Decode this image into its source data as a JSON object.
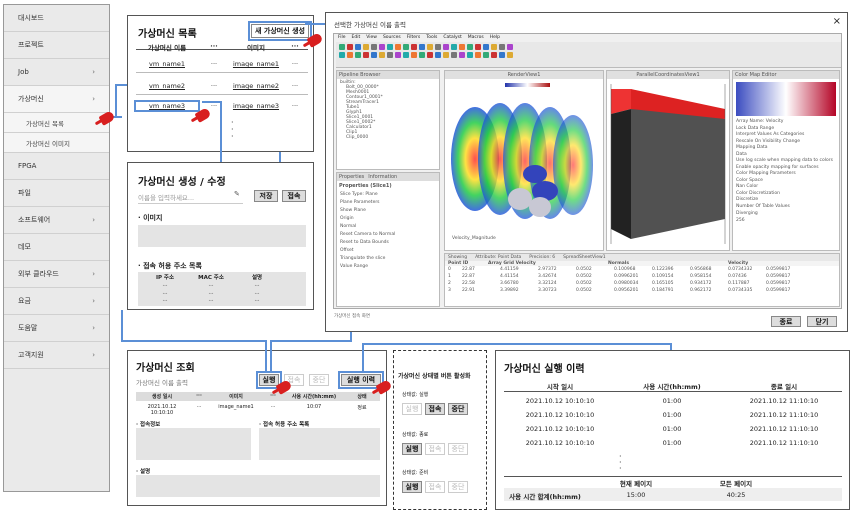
{
  "sidebar": {
    "items": [
      {
        "label": "대시보드",
        "chev": ""
      },
      {
        "label": "프로젝트",
        "chev": ""
      },
      {
        "label": "Job",
        "chev": "›"
      },
      {
        "label": "가상머신",
        "chev": "›"
      }
    ],
    "subitems": [
      "가상머신 목록",
      "가상머신 이미지"
    ],
    "items2": [
      {
        "label": "FPGA",
        "chev": ""
      },
      {
        "label": "파일",
        "chev": ""
      },
      {
        "label": "소프트웨어",
        "chev": "›"
      },
      {
        "label": "데모",
        "chev": ""
      },
      {
        "label": "외부 클라우드",
        "chev": "›"
      },
      {
        "label": "요금",
        "chev": "›"
      },
      {
        "label": "도움말",
        "chev": "›"
      },
      {
        "label": "고객지원",
        "chev": "›"
      }
    ]
  },
  "vm_list": {
    "title": "가상머신 목록",
    "new_button": "새 가상머신 생성",
    "headers": [
      "가상머신 이름",
      "···",
      "이미지",
      "···"
    ],
    "rows": [
      [
        "vm_name1",
        "···",
        "image_name1",
        "···"
      ],
      [
        "vm_name2",
        "···",
        "image_name2",
        "···"
      ],
      [
        "vm_name3",
        "···",
        "image_name3",
        "···"
      ]
    ],
    "more": "·"
  },
  "vm_edit": {
    "title": "가상머신 생성 / 수정",
    "name_placeholder": "이름을 입력하세요...",
    "save": "저장",
    "connect": "접속",
    "image_label": "· 이미지",
    "access_label": "· 접속 허용 주소 목록",
    "access_headers": [
      "IP 주소",
      "MAC 주소",
      "설명"
    ],
    "access_rows": [
      [
        "···",
        "···",
        "···"
      ],
      [
        "···",
        "···",
        "···"
      ],
      [
        "···",
        "···",
        "···"
      ]
    ]
  },
  "vm_view": {
    "title": "가상머신 조회",
    "subtitle": "가상머신 이름 출력",
    "buttons": {
      "run": "실행",
      "connect": "접속",
      "stop": "중단",
      "history": "실행 이력"
    },
    "headers": [
      "생성 일시",
      "···",
      "이미지",
      "···",
      "사용 시간(hh:mm)",
      "상태"
    ],
    "row": [
      "2021.10.12 10:10:10",
      "···",
      "image_name1",
      "···",
      "10:07",
      "정료"
    ],
    "sec_connect": "· 접속정보",
    "sec_access": "· 접속 허용 주소 목록",
    "sec_desc": "· 설명"
  },
  "states": {
    "title": "가상머신 상태별 버튼 활성화",
    "groups": [
      {
        "label": "상태값: 실행",
        "run": "실행",
        "connect": "접속",
        "stop": "중단"
      },
      {
        "label": "상태값: 종료",
        "run": "실행",
        "connect": "접속",
        "stop": "중단"
      },
      {
        "label": "상태값: 준비",
        "run": "실행",
        "connect": "접속",
        "stop": "중단"
      }
    ]
  },
  "history": {
    "title": "가상머신 실행 이력",
    "headers": [
      "시작 일시",
      "사용 시간(hh:mm)",
      "종료 일시"
    ],
    "rows": [
      [
        "2021.10.12 10:10:10",
        "01:00",
        "2021.10.12 11:10:10"
      ],
      [
        "2021.10.12 10:10:10",
        "01:00",
        "2021.10.12 11:10:10"
      ],
      [
        "2021.10.12 10:10:10",
        "01:00",
        "2021.10.12 11:10:10"
      ],
      [
        "2021.10.12 10:10:10",
        "01:00",
        "2021.10.12 11:10:10"
      ]
    ],
    "more": "·",
    "footer_headers": [
      "현재 페이지",
      "모든 페이지"
    ],
    "footer_label": "사용 시간 합계(hh:mm)",
    "footer_values": [
      "15:00",
      "40:25"
    ]
  },
  "remote": {
    "title": "선택한 가상머신 이름 출력",
    "close": "×",
    "menu": [
      "File",
      "Edit",
      "View",
      "Sources",
      "Filters",
      "Tools",
      "Catalyst",
      "Macros",
      "Help"
    ],
    "pipeline_title": "Pipeline Browser",
    "tree": [
      "builtin:",
      "Bolt_00_0000*",
      "Mesh0001",
      "Contour1_0001*",
      "StreamTracer1",
      "Tube1",
      "Glyph1",
      "Slice1_0001",
      "Slice1_0002*",
      "Calculator1",
      "Clip1",
      "Clip_0000"
    ],
    "props_tabs": [
      "Properties",
      "Information"
    ],
    "props_title": "Properties (Slice1)",
    "props_items": [
      "Slice Type: Plane",
      "Plane Parameters",
      "Show Plane",
      "Origin",
      "Normal",
      "Reset Camera to Normal",
      "Reset to Data Bounds",
      "Offset",
      "Triangulate the slice",
      "Value Range"
    ],
    "view_title": "RenderView1",
    "chart_title": "ParallelCoordinatesView1",
    "colormap_title": "Color Map Editor",
    "colormap_items": [
      "Array Name: Velocity",
      "Lock Data Range",
      "Interpret Values As Categories",
      "Rescale On Visibility Change",
      "Mapping Data",
      "Data",
      "Use log scale when mapping data to colors",
      "Enable opacity mapping for surfaces",
      "Color Mapping Parameters",
      "Color Space",
      "Nan Color",
      "Color Discretization",
      "Discretize",
      "Number Of Table Values"
    ],
    "colorspace_value": "Diverging",
    "table_values": "256",
    "spreadsheet_title": "SpreadSheetView1",
    "showing_label": "Showing",
    "attribute_label": "Attribute: Point Data",
    "precision_label": "Precision: 6",
    "sheet_headers": [
      "Point ID",
      "Array Grid Velocity",
      "Normals",
      "Velocity"
    ],
    "sheet_rows": [
      [
        "0",
        "22.87",
        "4.41159",
        "2.97372",
        "0.0502",
        "0.100968",
        "0.122396",
        "0.956868",
        "0.0734332",
        "0.0599817"
      ],
      [
        "1",
        "22.87",
        "4.41154",
        "3.42674",
        "0.0502",
        "0.0996201",
        "0.109154",
        "0.958154",
        "0.07436",
        "0.0599817"
      ],
      [
        "2",
        "22.58",
        "3.66780",
        "3.32124",
        "0.0502",
        "0.0980034",
        "0.165105",
        "0.934172",
        "0.117887",
        "0.0599817"
      ],
      [
        "3",
        "22.91",
        "3.39892",
        "3.30723",
        "0.0502",
        "0.0956201",
        "0.184791",
        "0.962172",
        "0.0734335",
        "0.0599817"
      ]
    ],
    "status": "가상머신 접속 화면",
    "footer_buttons": [
      "종료",
      "닫기"
    ],
    "legend_label": "Velocity_Magnitude"
  },
  "colors": {
    "accent_blue": "#5b8fd6",
    "hand_red": "#d81f1f",
    "sidebar_bg": "#eaeaea"
  }
}
